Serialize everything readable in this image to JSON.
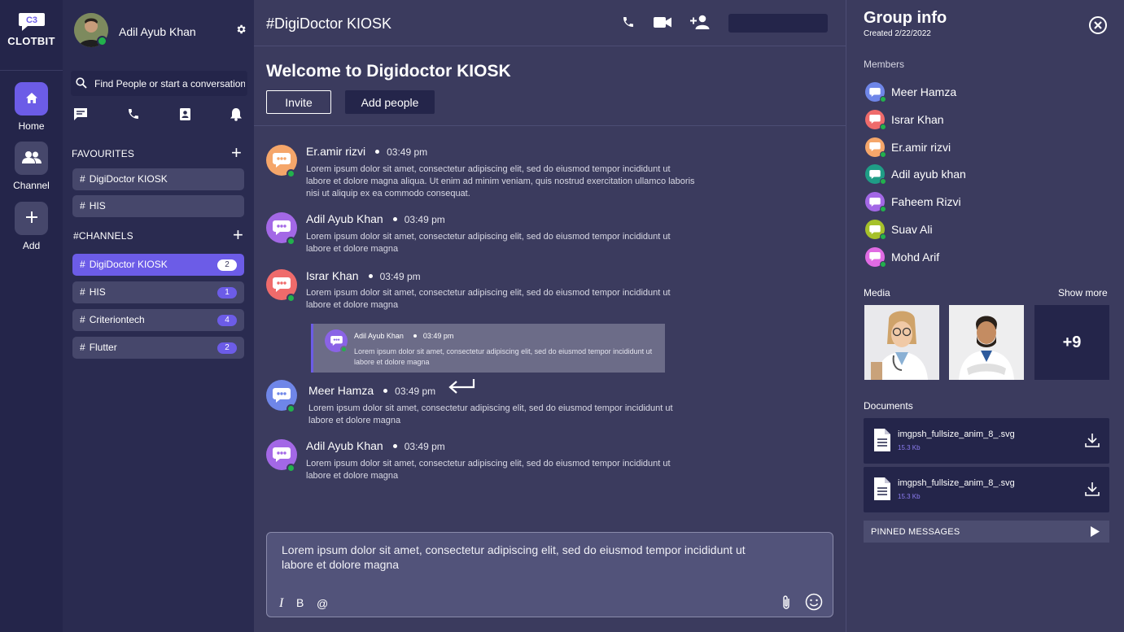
{
  "colors": {
    "rail": "#24254a",
    "sidebar": "#2a2b50",
    "main": "#3b3b5e",
    "accent": "#6c5ce7",
    "online": "#22b14c"
  },
  "rail": {
    "brand_logo": "C3",
    "brand": "CLOTBIT",
    "items": [
      {
        "label": "Home",
        "icon": "home-icon"
      },
      {
        "label": "Channel",
        "icon": "group-icon"
      },
      {
        "label": "Add",
        "icon": "plus-icon"
      }
    ]
  },
  "sidebar": {
    "user_name": "Adil Ayub Khan",
    "search_placeholder": "Find People or start a conversation",
    "favourites_label": "FAVOURITES",
    "favourites": [
      {
        "name": "DigiDoctor KIOSK"
      },
      {
        "name": "HIS"
      }
    ],
    "channels_label": "#CHANNELS",
    "channels": [
      {
        "name": "DigiDoctor KIOSK",
        "count": "2"
      },
      {
        "name": "HIS",
        "count": "1"
      },
      {
        "name": "Criteriontech",
        "count": "4"
      },
      {
        "name": "Flutter",
        "count": "2"
      }
    ]
  },
  "main": {
    "channel_title": "#DigiDoctor KIOSK",
    "welcome": "Welcome to Digidoctor KIOSK",
    "invite_label": "Invite",
    "add_people_label": "Add people",
    "messages": [
      {
        "author": "Er.amir rizvi",
        "time": "03:49 pm",
        "text": "Lorem ipsum dolor sit amet, consectetur adipiscing elit, sed do eiusmod tempor incididunt ut labore et dolore magna aliqua. Ut enim ad minim veniam, quis nostrud exercitation ullamco laboris nisi ut aliquip ex ea commodo consequat."
      },
      {
        "author": "Adil Ayub Khan",
        "time": "03:49 pm",
        "text": "Lorem ipsum dolor sit amet, consectetur adipiscing elit, sed do eiusmod tempor incididunt ut labore et dolore magna"
      },
      {
        "author": "Israr Khan",
        "time": "03:49 pm",
        "text": "Lorem ipsum dolor sit amet, consectetur adipiscing elit, sed do eiusmod tempor incididunt ut labore et dolore magna"
      },
      {
        "author": "Meer Hamza",
        "time": "03:49 pm",
        "text": "Lorem ipsum dolor sit amet, consectetur adipiscing elit, sed do eiusmod tempor incididunt ut labore et dolore magna"
      },
      {
        "author": "Adil Ayub Khan",
        "time": "03:49 pm",
        "text": "Lorem ipsum dolor sit amet, consectetur adipiscing elit, sed do eiusmod tempor incididunt ut labore et dolore magna"
      }
    ],
    "quote": {
      "author": "Adil Ayub Khan",
      "time": "03:49 pm",
      "text": "Lorem ipsum dolor sit amet, consectetur adipiscing elit, sed do eiusmod tempor incididunt ut labore et dolore magna"
    },
    "composer_text": "Lorem ipsum dolor sit amet, consectetur adipiscing elit, sed do eiusmod tempor incididunt ut labore et dolore magna",
    "format": {
      "italic": "I",
      "bold": "B",
      "mention": "@"
    }
  },
  "panel": {
    "title": "Group info",
    "created": "Created 2/22/2022",
    "members_label": "Members",
    "members": [
      {
        "name": "Meer Hamza",
        "color": "#6f86e8"
      },
      {
        "name": "Israr Khan",
        "color": "#ef6b6b"
      },
      {
        "name": "Er.amir rizvi",
        "color": "#f5a66a"
      },
      {
        "name": "Adil ayub khan",
        "color": "#1f9d86"
      },
      {
        "name": "Faheem Rizvi",
        "color": "#a368e6"
      },
      {
        "name": "Suav Ali",
        "color": "#a6c12a"
      },
      {
        "name": "Mohd Arif",
        "color": "#e06be3"
      }
    ],
    "media_label": "Media",
    "show_more": "Show more",
    "media_more": "+9",
    "documents_label": "Documents",
    "documents": [
      {
        "name": "imgpsh_fullsize_anim_8_.svg",
        "size": "15.3 Kb"
      },
      {
        "name": "imgpsh_fullsize_anim_8_.svg",
        "size": "15.3 Kb"
      }
    ],
    "pinned_label": "PINNED MESSAGES"
  }
}
